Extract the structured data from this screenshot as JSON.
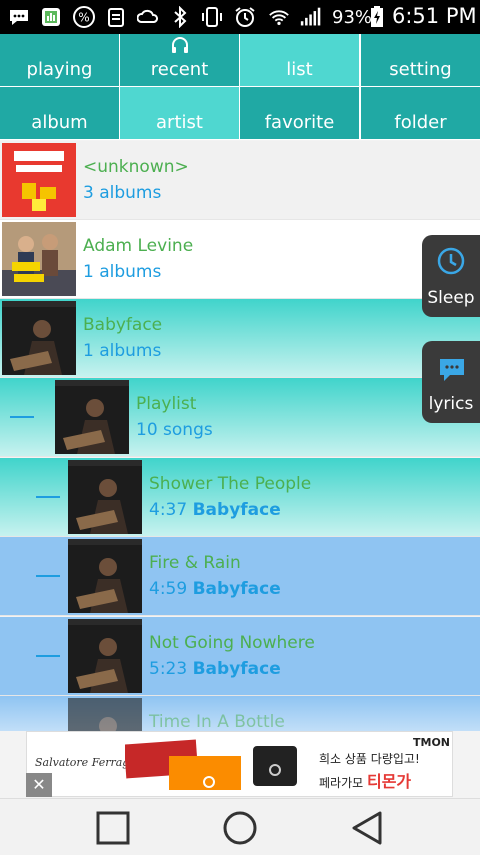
{
  "status_bar": {
    "battery_percent": "93%",
    "time": "6:51 PM",
    "icons": [
      "message-icon",
      "photo-icon",
      "percent-icon",
      "clipboard-icon",
      "weather-icon",
      "bluetooth-icon",
      "vibrate-icon",
      "alarm-icon",
      "wifi-icon",
      "signal-icon",
      "battery-icon"
    ]
  },
  "tabs": {
    "row1": [
      "playing",
      "recent",
      "list",
      "setting"
    ],
    "row2": [
      "album",
      "artist",
      "favorite",
      "folder"
    ],
    "active": [
      "list",
      "artist"
    ]
  },
  "list": {
    "items": [
      {
        "title": "<unknown>",
        "subtitle": "3 albums"
      },
      {
        "title": "Adam Levine",
        "subtitle": "1 albums"
      },
      {
        "title": "Babyface",
        "subtitle": "1 albums"
      },
      {
        "title": "Playlist",
        "subtitle": "10 songs"
      },
      {
        "title": "Shower The People",
        "duration": "4:37",
        "artist": "Babyface"
      },
      {
        "title": "Fire & Rain",
        "duration": "4:59",
        "artist": "Babyface"
      },
      {
        "title": "Not Going Nowhere",
        "duration": "5:23",
        "artist": "Babyface"
      },
      {
        "title": "Time In A Bottle"
      }
    ]
  },
  "floating": {
    "sleep_label": "Sleep",
    "lyrics_label": "lyrics"
  },
  "ad": {
    "brand": "Salvatore Ferragamo",
    "logo": "TMON",
    "line1": "희소 상품 다량입고!",
    "line2_prefix": "페라가모 ",
    "line2_highlight": "티몬가",
    "close": "✕"
  },
  "colors": {
    "tab": "#20a9a4",
    "tab_active": "#4fd7d0",
    "title_green": "#4caf50",
    "subtitle_blue": "#1e9de0",
    "playing_blue": "#8fc4f2"
  }
}
